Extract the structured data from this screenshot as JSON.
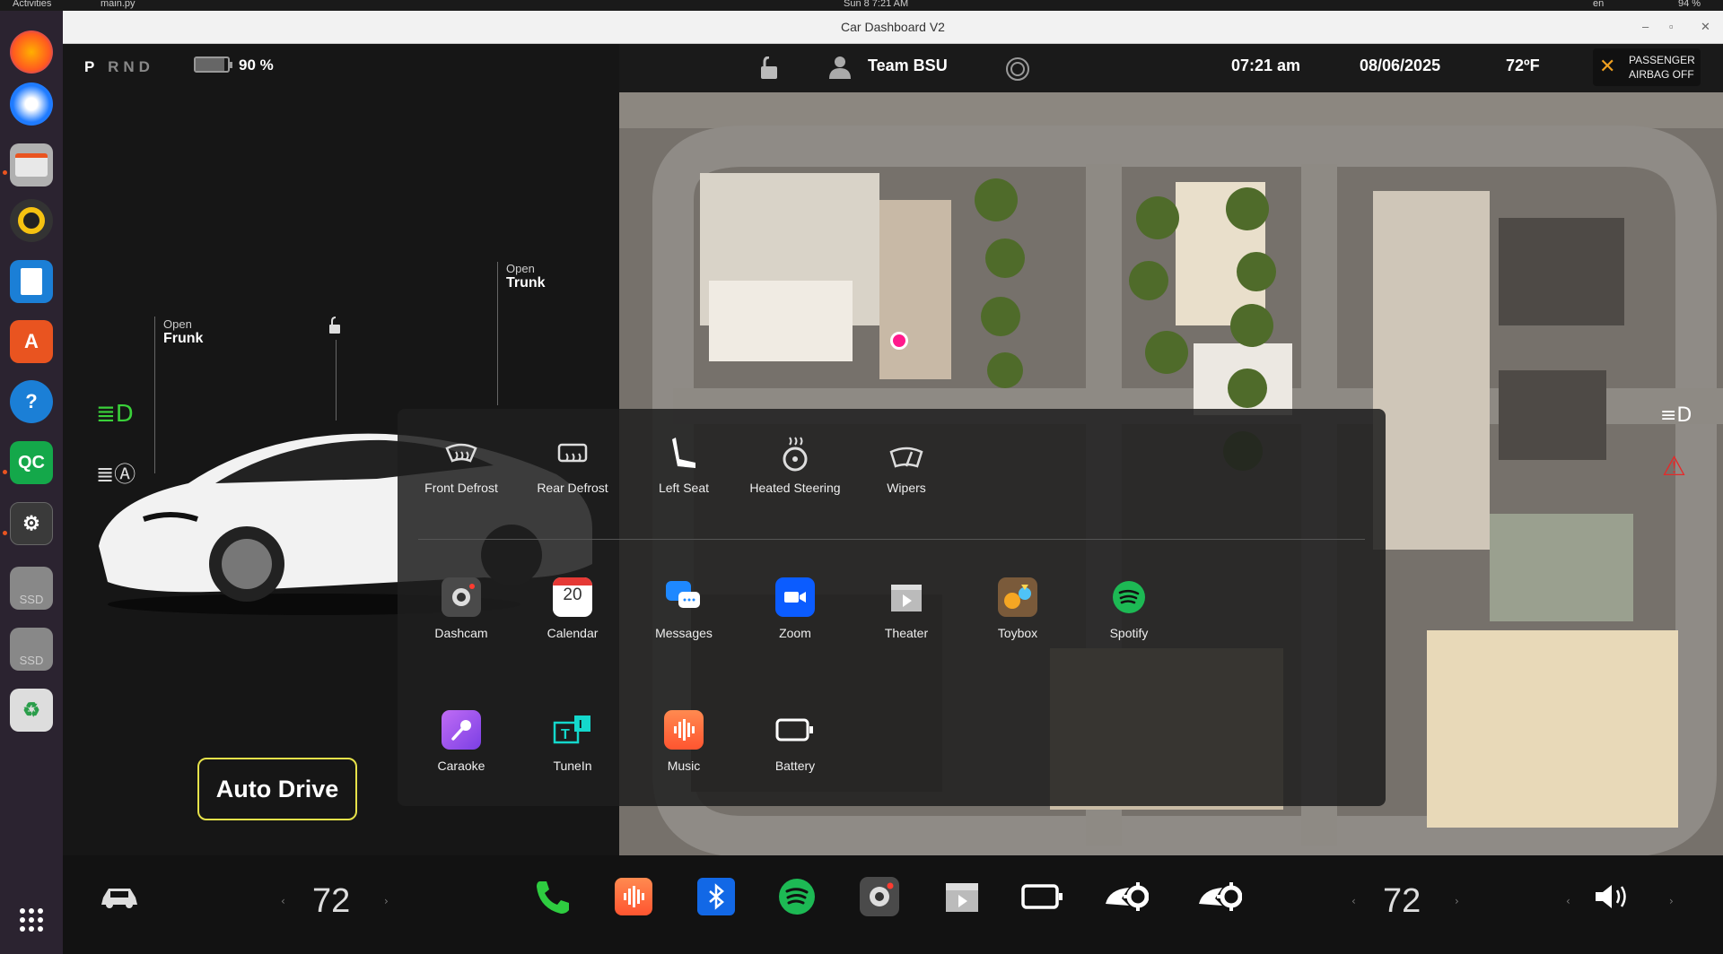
{
  "system": {
    "activities": "Activities",
    "app_menu": "main.py",
    "clock": "Sun 8  7:21 AM",
    "lang": "en",
    "battery_sys": "94 %"
  },
  "window": {
    "title": "Car Dashboard V2"
  },
  "header": {
    "gear": {
      "p": "P",
      "rnd": "RND"
    },
    "battery_pct": "90 %",
    "profile": "Team BSU",
    "time": "07:21 am",
    "date": "08/06/2025",
    "temperature": "72ºF",
    "airbag_line1": "PASSENGER",
    "airbag_line2": "AIRBAG OFF"
  },
  "car": {
    "frunk": {
      "action": "Open",
      "label": "Frunk"
    },
    "trunk": {
      "action": "Open",
      "label": "Trunk"
    },
    "auto_drive": "Auto Drive"
  },
  "controls": [
    {
      "label": "Front Defrost",
      "icon": "front-defrost-icon"
    },
    {
      "label": "Rear Defrost",
      "icon": "rear-defrost-icon"
    },
    {
      "label": "Left Seat",
      "icon": "seat-icon"
    },
    {
      "label": "Heated Steering",
      "icon": "heated-steering-icon"
    },
    {
      "label": "Wipers",
      "icon": "wipers-icon"
    }
  ],
  "apps": [
    {
      "label": "Dashcam",
      "icon": "dashcam-icon",
      "color": "#4a4a4a"
    },
    {
      "label": "Calendar",
      "icon": "calendar-icon",
      "color": "#ffffff",
      "value": "20"
    },
    {
      "label": "Messages",
      "icon": "messages-icon",
      "color": "#1e88ff"
    },
    {
      "label": "Zoom",
      "icon": "zoom-icon",
      "color": "#0b5cff"
    },
    {
      "label": "Theater",
      "icon": "theater-icon",
      "color": "#555555"
    },
    {
      "label": "Toybox",
      "icon": "toybox-icon",
      "color": "#7a5a3a"
    },
    {
      "label": "Spotify",
      "icon": "spotify-icon",
      "color": "#1db954"
    },
    {
      "label": "Caraoke",
      "icon": "caraoke-icon",
      "color": "#a05cf0"
    },
    {
      "label": "TuneIn",
      "icon": "tunein-icon",
      "color": "#14d8cc"
    },
    {
      "label": "Music",
      "icon": "music-icon",
      "color": "#ff6a3d"
    },
    {
      "label": "Battery",
      "icon": "battery-icon",
      "color": "#ffffff"
    }
  ],
  "bottom": {
    "temp_left": "72",
    "temp_right": "72"
  },
  "dock": [
    "firefox-icon",
    "thunderbird-icon",
    "files-icon",
    "rhythmbox-icon",
    "writer-icon",
    "app-center-icon",
    "help-icon",
    "qc-icon",
    "settings-icon",
    "ssd-icon",
    "ssd-icon",
    "trash-icon",
    "app-grid-icon"
  ],
  "dock_labels": {
    "qc": "QC",
    "ssd": "SSD"
  }
}
